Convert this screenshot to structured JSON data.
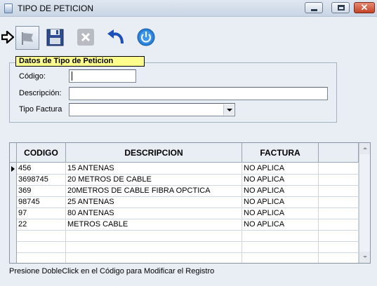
{
  "window": {
    "title": "TIPO DE PETICION",
    "close_glyph": "✕"
  },
  "toolbar": {
    "buttons": [
      {
        "name": "new",
        "icon": "flag-icon"
      },
      {
        "name": "save",
        "icon": "floppy-disk-icon"
      },
      {
        "name": "delete",
        "icon": "close-x-icon"
      },
      {
        "name": "undo",
        "icon": "undo-arrow-icon"
      },
      {
        "name": "exit",
        "icon": "power-icon"
      }
    ]
  },
  "form": {
    "legend": "Datos de Tipo de Peticion",
    "codigo_label": "Código:",
    "codigo_value": "",
    "descripcion_label": "Descripción:",
    "descripcion_value": "",
    "tipo_factura_label": "Tipo Factura",
    "tipo_factura_value": ""
  },
  "grid": {
    "columns": [
      "CODIGO",
      "DESCRIPCION",
      "FACTURA",
      ""
    ],
    "rows": [
      [
        "456",
        "15  ANTENAS",
        "NO APLICA"
      ],
      [
        "3698745",
        "20 METROS DE CABLE",
        "NO APLICA"
      ],
      [
        "369",
        "20METROS DE CABLE FIBRA OPCTICA",
        "NO APLICA"
      ],
      [
        "98745",
        "25 ANTENAS",
        "NO APLICA"
      ],
      [
        "97",
        "80 ANTENAS",
        "NO APLICA"
      ],
      [
        "22",
        "METROS CABLE",
        "NO APLICA"
      ]
    ],
    "empty_rows": 3
  },
  "status": {
    "hint": "Presione DobleClick en el Código para Modificar el Registro"
  },
  "colors": {
    "legend_bg": "#ffff8e",
    "window_bg": "#e9eef4",
    "close_button": "#c34326"
  }
}
